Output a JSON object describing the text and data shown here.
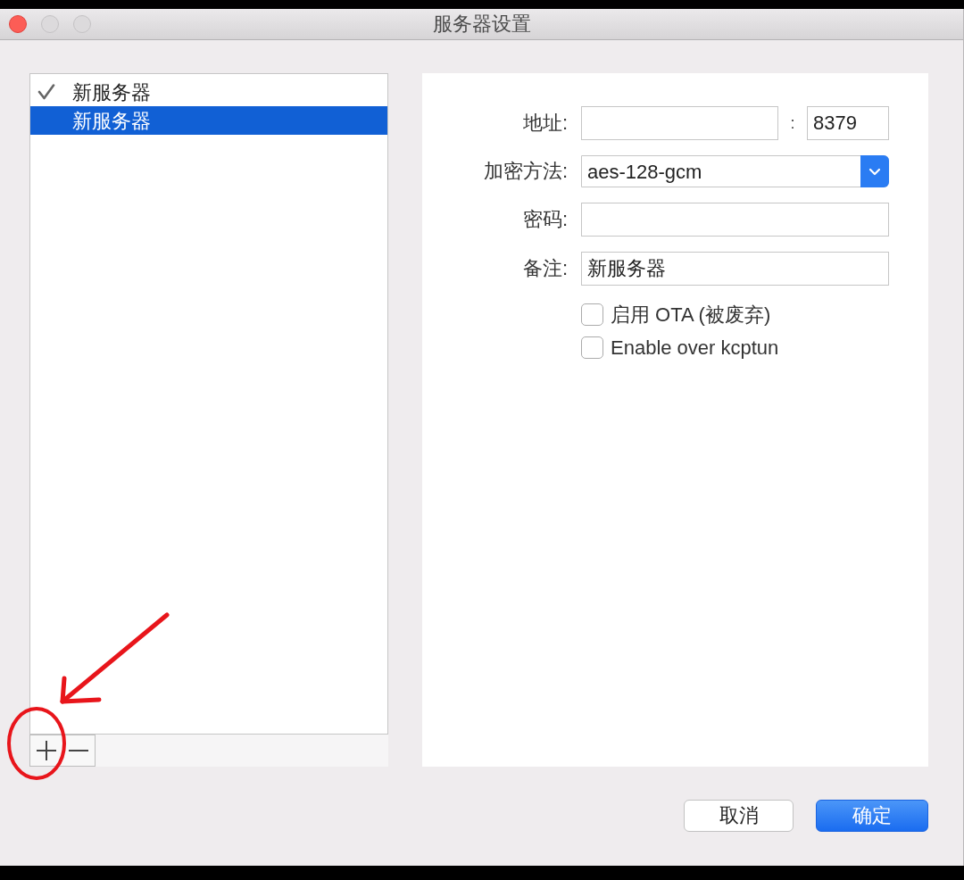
{
  "window": {
    "title": "服务器设置"
  },
  "servers": [
    {
      "name": "新服务器",
      "checked": true,
      "selected": false
    },
    {
      "name": "新服务器",
      "checked": false,
      "selected": true
    }
  ],
  "form": {
    "address": {
      "label": "地址:",
      "separator": ":",
      "port": "8379"
    },
    "encryption": {
      "label": "加密方法:",
      "value": "aes-128-gcm"
    },
    "password": {
      "label": "密码:"
    },
    "remark": {
      "label": "备注:",
      "value": "新服务器"
    },
    "options": [
      {
        "label": "启用 OTA (被废弃)",
        "checked": false
      },
      {
        "label": "Enable over kcptun",
        "checked": false
      }
    ]
  },
  "buttons": [
    {
      "label": "取消",
      "kind": "secondary"
    },
    {
      "label": "确定",
      "kind": "primary"
    }
  ]
}
